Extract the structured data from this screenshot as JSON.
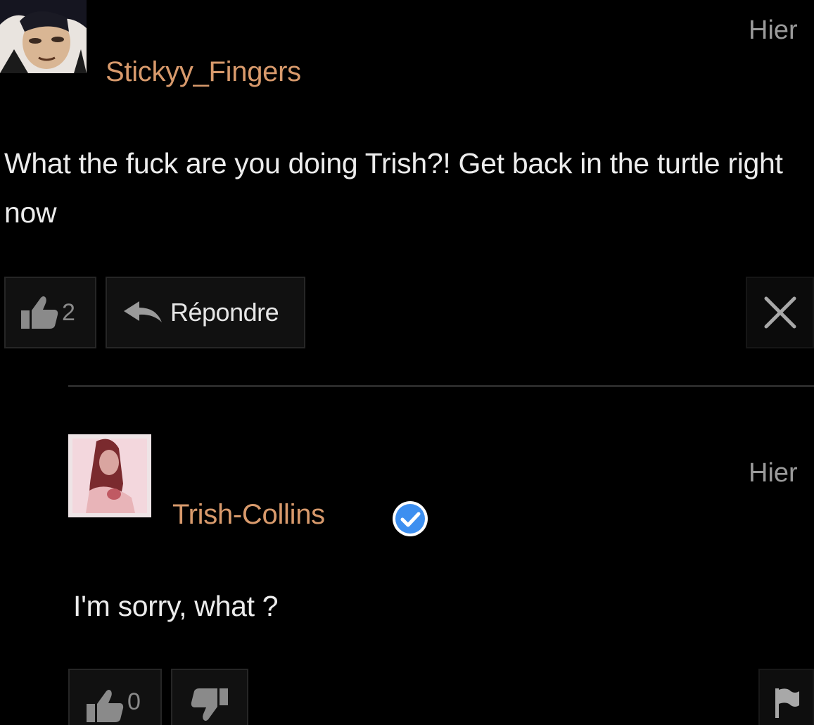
{
  "comments": [
    {
      "username": "Stickyy_Fingers",
      "timestamp": "Hier",
      "text": "What the fuck are you doing Trish?! Get back in the turtle right now",
      "likes": "2",
      "reply_label": "Répondre",
      "close_icon": "close-icon"
    },
    {
      "username": "Trish-Collins",
      "verified": true,
      "timestamp": "Hier",
      "text": "I'm sorry, what ?",
      "likes": "0",
      "flag_icon": "flag-icon"
    }
  ],
  "colors": {
    "background": "#000000",
    "username": "#d89a6c",
    "text": "#ececec",
    "muted": "#9a9a9a",
    "verified": "#3d8ff0"
  }
}
